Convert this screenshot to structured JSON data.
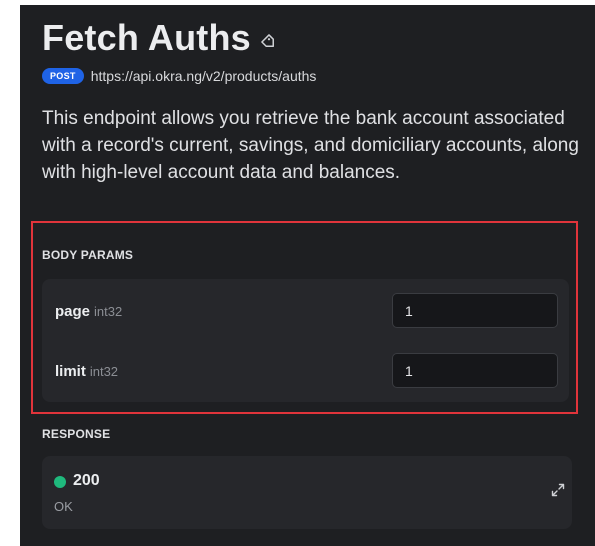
{
  "endpoint": {
    "title": "Fetch Auths",
    "method": "POST",
    "url": "https://api.okra.ng/v2/products/auths",
    "description": "This endpoint allows you retrieve the bank account associated with a record's current, savings, and domiciliary accounts, along with high-level account data and balances."
  },
  "body_params": {
    "label": "BODY PARAMS",
    "params": [
      {
        "name": "page",
        "type": "int32",
        "value": "1"
      },
      {
        "name": "limit",
        "type": "int32",
        "value": "1"
      }
    ]
  },
  "response": {
    "label": "RESPONSE",
    "status_code": "200",
    "status_text": "OK",
    "status_color": "#1fb97d"
  },
  "colors": {
    "background": "#1e1f22",
    "card": "#26272b",
    "method_badge": "#1f63e6",
    "highlight_border": "#e1343b"
  },
  "icons": {
    "title": "tag-icon",
    "response_expand": "expand-arrows-icon"
  }
}
